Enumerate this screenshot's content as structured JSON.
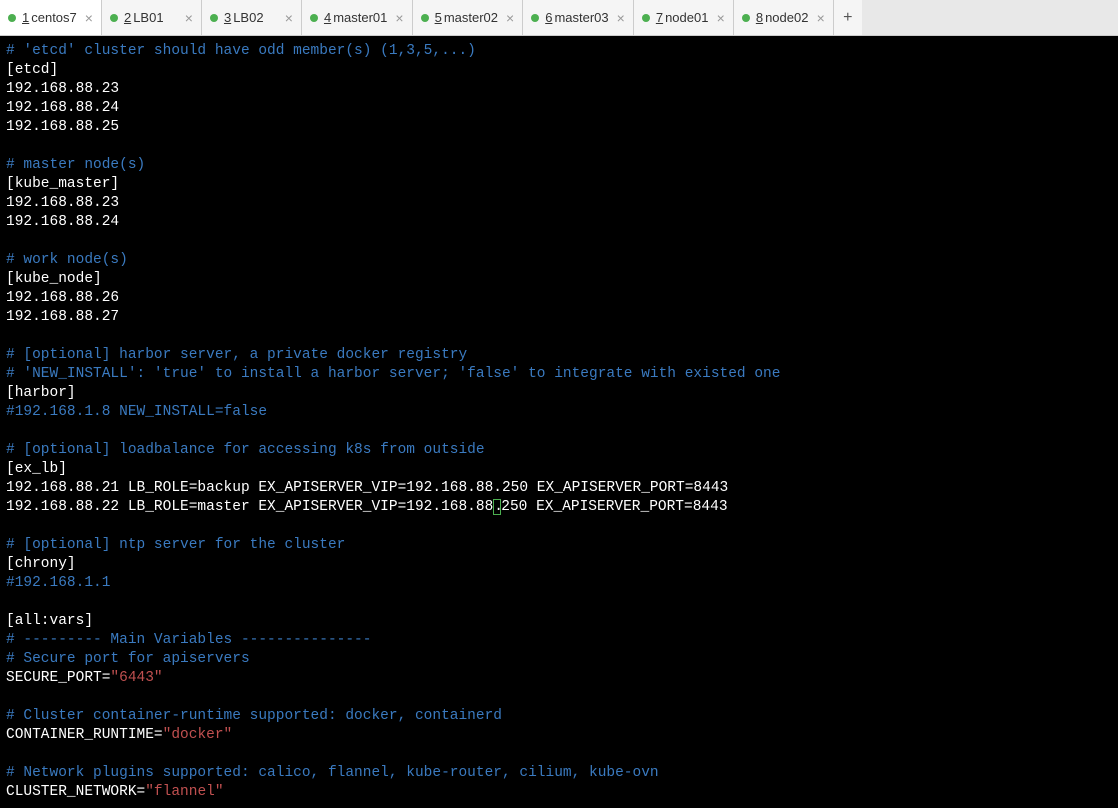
{
  "tabs": [
    {
      "num": "1",
      "label": "centos7",
      "active": true
    },
    {
      "num": "2",
      "label": "LB01",
      "active": false
    },
    {
      "num": "3",
      "label": "LB02",
      "active": false
    },
    {
      "num": "4",
      "label": "master01",
      "active": false
    },
    {
      "num": "5",
      "label": "master02",
      "active": false
    },
    {
      "num": "6",
      "label": "master03",
      "active": false
    },
    {
      "num": "7",
      "label": "node01",
      "active": false
    },
    {
      "num": "8",
      "label": "node02",
      "active": false
    }
  ],
  "lines": {
    "c1": "# 'etcd' cluster should have odd member(s) (1,3,5,...)",
    "l2": "[etcd]",
    "l3": "192.168.88.23",
    "l4": "192.168.88.24",
    "l5": "192.168.88.25",
    "c6": "# master node(s)",
    "l7": "[kube_master]",
    "l8": "192.168.88.23",
    "l9": "192.168.88.24",
    "c10": "# work node(s)",
    "l11": "[kube_node]",
    "l12": "192.168.88.26",
    "l13": "192.168.88.27",
    "c14": "# [optional] harbor server, a private docker registry",
    "c15": "# 'NEW_INSTALL': 'true' to install a harbor server; 'false' to integrate with existed one",
    "l16": "[harbor]",
    "c17": "#192.168.1.8 NEW_INSTALL=false",
    "c18": "# [optional] loadbalance for accessing k8s from outside",
    "l19": "[ex_lb]",
    "l20": "192.168.88.21 LB_ROLE=backup EX_APISERVER_VIP=192.168.88.250 EX_APISERVER_PORT=8443",
    "l21a": "192.168.88.22 LB_ROLE=master EX_APISERVER_VIP=192.168.88",
    "l21b": ".",
    "l21c": "250 EX_APISERVER_PORT=8443",
    "c22": "# [optional] ntp server for the cluster",
    "l23": "[chrony]",
    "c24": "#192.168.1.1",
    "l25": "[all:vars]",
    "c26": "# --------- Main Variables ---------------",
    "c27": "# Secure port for apiservers",
    "l28a": "SECURE_PORT=",
    "s28": "\"6443\"",
    "c29": "# Cluster container-runtime supported: docker, containerd",
    "l30a": "CONTAINER_RUNTIME=",
    "s30": "\"docker\"",
    "c31": "# Network plugins supported: calico, flannel, kube-router, cilium, kube-ovn",
    "l32a": "CLUSTER_NETWORK=",
    "s32": "\"flannel\""
  }
}
